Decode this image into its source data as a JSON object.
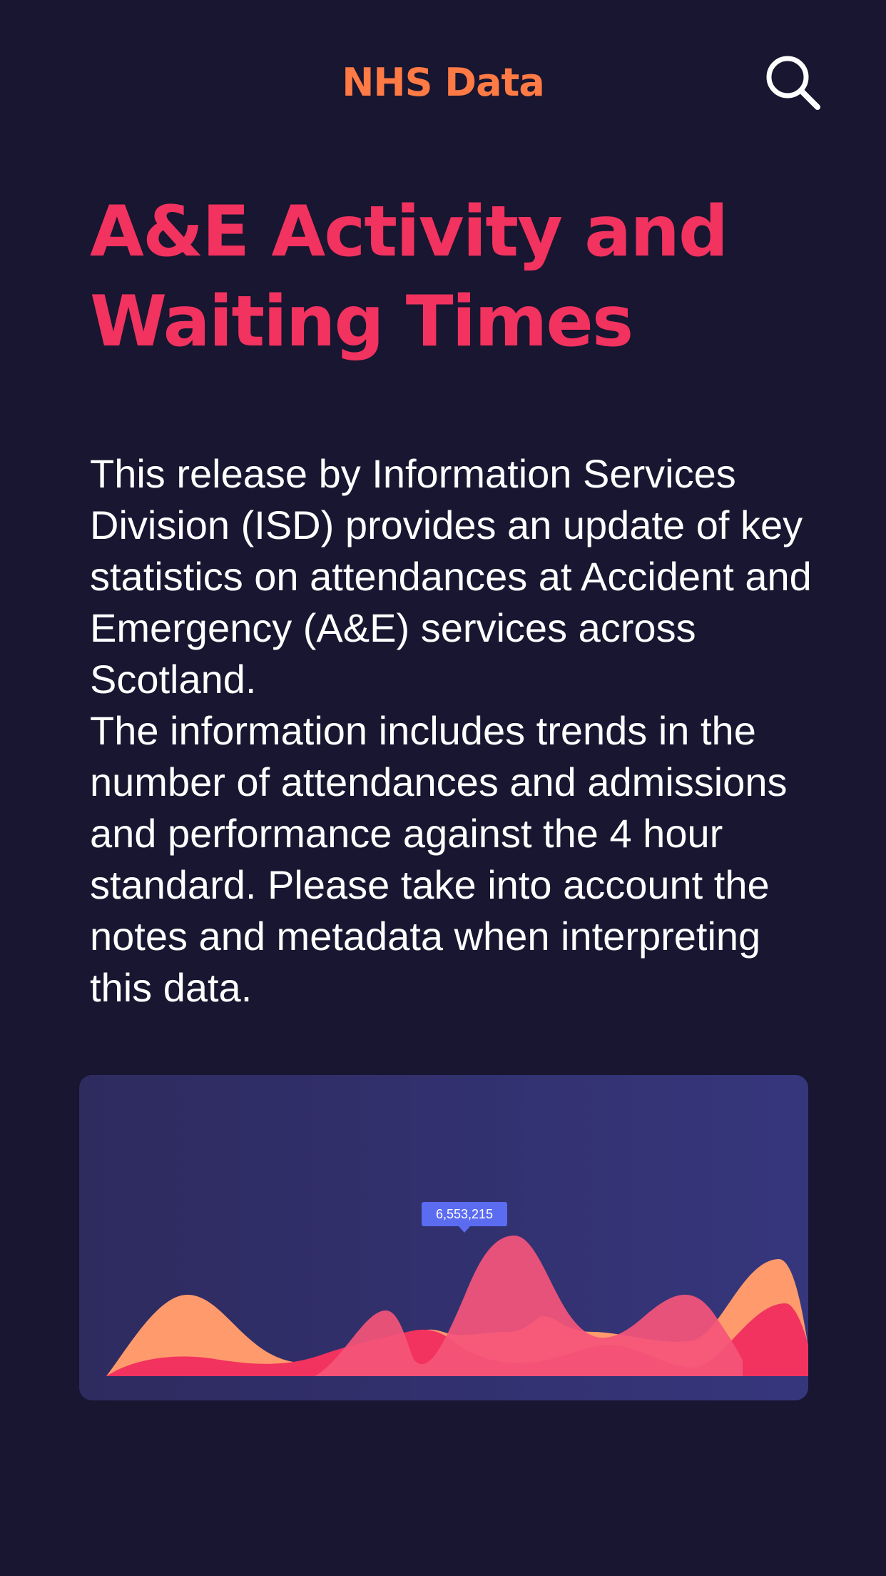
{
  "header": {
    "app_title": "NHS Data",
    "search_icon": "search-icon"
  },
  "page": {
    "title": "A&E Activity and Waiting Times",
    "intro_paragraphs": [
      "This release by Information Services Division (ISD) provides an update of key statistics on attendances at Accident and Emergency (A&E) services across Scotland.",
      "The information includes trends in the number of attendances and admissions and performance against the 4 hour standard. Please take into account the notes and metadata when interpreting this data."
    ]
  },
  "colors": {
    "background": "#181630",
    "brand_orange": "#ff7a45",
    "title_pink": "#f2325f",
    "card_start": "#2e2b5f",
    "card_end": "#36367d",
    "tooltip": "#5b6cf0"
  },
  "chart_data": {
    "type": "area",
    "tooltip_label": "6,553,215",
    "series": [
      {
        "color": "#ff9a6c"
      },
      {
        "color": "#f2325f"
      },
      {
        "color": "#f5557a"
      }
    ]
  }
}
